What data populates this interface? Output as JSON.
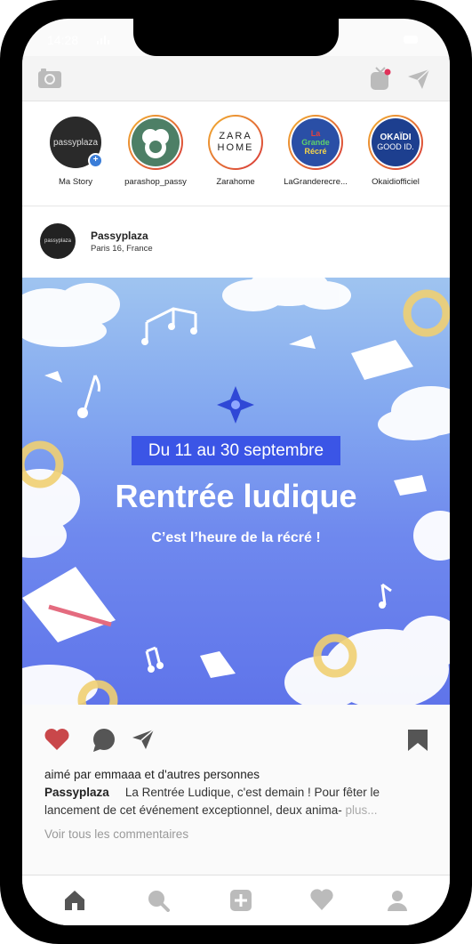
{
  "status": {
    "time": "14:28"
  },
  "stories": [
    {
      "label": "Ma Story",
      "pic_text": "passyplaza"
    },
    {
      "label": "parashop_passy"
    },
    {
      "label": "Zarahome",
      "pic_text_1": "ZARA",
      "pic_text_2": "HOME"
    },
    {
      "label": "LaGranderecre...",
      "pic_text_1": "La",
      "pic_text_2": "Grande",
      "pic_text_3": "Récré"
    },
    {
      "label": "Okaidiofficiel",
      "pic_text_1": "OKAÏDI",
      "pic_text_2": "GOOD ID."
    }
  ],
  "post": {
    "avatar_text": "passyplaza",
    "username": "Passyplaza",
    "location": "Paris 16, France",
    "image": {
      "dates": "Du 11 au 30 septembre",
      "headline": "Rentrée ludique",
      "subline": "C’est l’heure de la récré !"
    },
    "liked_by": "aimé par emmaaa et d'autres personnes",
    "caption_user": "Passyplaza",
    "caption_text": "La Rentrée Ludique, c'est demain ! Pour fêter le lancement de cet événement exceptionnel, deux anima-",
    "caption_more": "plus...",
    "view_comments": "Voir tous les commentaires"
  },
  "colors": {
    "heart": "#c9474a",
    "badge": "#3b55e6",
    "icons": "#555555"
  }
}
